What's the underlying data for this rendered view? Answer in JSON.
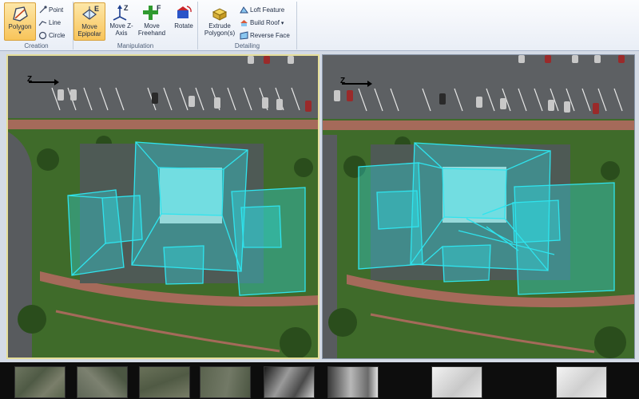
{
  "ribbon": {
    "creation": {
      "label": "Creation",
      "polygon": "Polygon",
      "point": "Point",
      "line": "Line",
      "circle": "Circle"
    },
    "manipulation": {
      "label": "Manipulation",
      "move_epipolar": "Move Epipolar",
      "move_z": "Move Z-Axis",
      "move_freehand": "Move Freehand",
      "rotate": "Rotate",
      "key_e": "E",
      "key_z": "Z",
      "key_f": "F"
    },
    "detailing": {
      "label": "Detailing",
      "extrude": "Extrude Polygon(s)",
      "loft": "Loft Feature",
      "build_roof": "Build Roof",
      "reverse_face": "Reverse Face"
    }
  },
  "colors": {
    "active_tool": "#f8c45a",
    "wireframe": "#2fe4ee",
    "grass": "#3f6b2a",
    "asphalt": "#5d6063"
  },
  "icons": [
    "polygon-icon",
    "point-icon",
    "line-icon",
    "circle-icon",
    "move-epipolar-icon",
    "move-z-axis-icon",
    "move-freehand-icon",
    "rotate-icon",
    "extrude-icon",
    "loft-icon",
    "build-roof-icon",
    "reverse-face-icon",
    "north-arrow-icon"
  ]
}
